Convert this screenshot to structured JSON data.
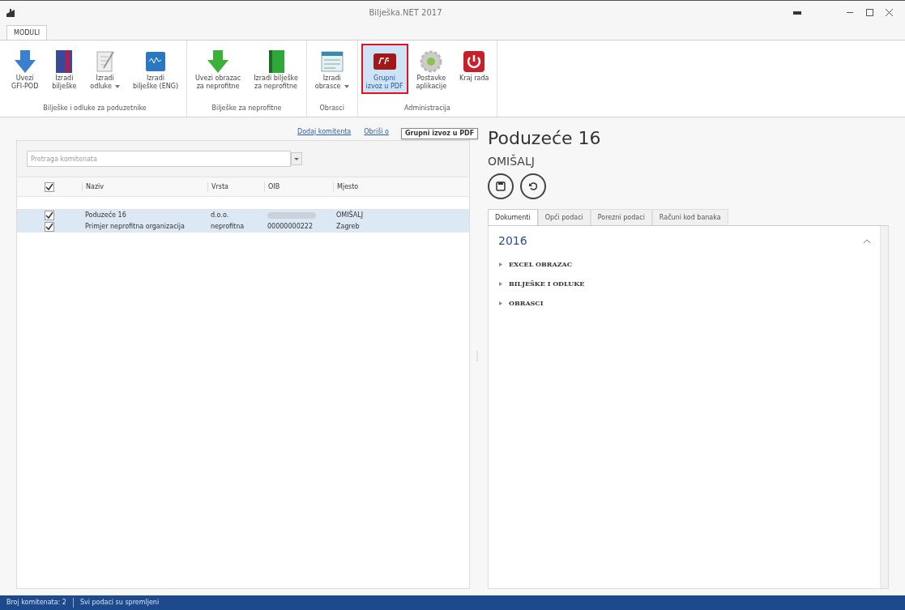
{
  "window": {
    "title": "Bilješka.NET 2017"
  },
  "ribbon": {
    "tabs": [
      {
        "label": "MODULI",
        "selected": true
      }
    ],
    "groups": [
      {
        "label": "Bilješke i odluke za poduzetnike",
        "buttons": [
          {
            "kind": "arrow-blue",
            "lines": [
              "Uvezi",
              "GFI-POD"
            ],
            "dropdown": false,
            "hovered": false
          },
          {
            "kind": "book-red",
            "lines": [
              "Izradi",
              "bilješke"
            ],
            "dropdown": false,
            "hovered": false
          },
          {
            "kind": "paper",
            "lines": [
              "Izradi",
              "odluke"
            ],
            "dropdown": true,
            "hovered": false
          },
          {
            "kind": "book-blue",
            "lines": [
              "Izradi",
              "bilješke (ENG)"
            ],
            "dropdown": false,
            "hovered": false
          }
        ]
      },
      {
        "label": "Bilješke za neprofitne",
        "buttons": [
          {
            "kind": "arrow-green",
            "lines": [
              "Uvezi obrazac",
              "za neprofitne"
            ],
            "dropdown": false,
            "hovered": false
          },
          {
            "kind": "book-green",
            "lines": [
              "Izradi bilješke",
              "za neprofitne"
            ],
            "dropdown": false,
            "hovered": false
          }
        ]
      },
      {
        "label": "Obrasci",
        "buttons": [
          {
            "kind": "form",
            "lines": [
              "Izradi",
              "obrasce"
            ],
            "dropdown": true,
            "hovered": false
          }
        ]
      },
      {
        "label": "Administracija",
        "buttons": [
          {
            "kind": "pdf",
            "lines": [
              "Grupni",
              "izvoz u PDF"
            ],
            "dropdown": false,
            "hovered": true
          },
          {
            "kind": "gear",
            "lines": [
              "Postavke",
              "aplikacije"
            ],
            "dropdown": false,
            "hovered": false
          },
          {
            "kind": "power",
            "lines": [
              "Kraj rada"
            ],
            "dropdown": false,
            "hovered": false
          }
        ]
      }
    ]
  },
  "tooltip": "Grupni izvoz u PDF",
  "links": [
    "Dodaj komitenta",
    "Obriši o"
  ],
  "search": {
    "placeholder": "Pretraga komitenata"
  },
  "table": {
    "all_checked": true,
    "columns": [
      "Naziv",
      "Vrsta",
      "OIB",
      "Mjesto"
    ],
    "rows": [
      {
        "checked": true,
        "selected": true,
        "cells": [
          "Poduzeće 16",
          "d.o.o.",
          null,
          "OMIŠALJ"
        ]
      },
      {
        "checked": true,
        "selected": true,
        "cells": [
          "Primjer neprofitna organizacija",
          "neprofitna",
          "00000000222",
          "Zagreb"
        ]
      }
    ]
  },
  "detail": {
    "title": "Poduzeće 16",
    "subtitle": "OMIŠALJ",
    "tabs": [
      {
        "label": "Dokumenti",
        "selected": true
      },
      {
        "label": "Opći podaci",
        "selected": false
      },
      {
        "label": "Porezni podaci",
        "selected": false
      },
      {
        "label": "Računi kod banaka",
        "selected": false
      }
    ],
    "section": {
      "label": "2016",
      "expanded": true,
      "items": [
        {
          "label": "EXCEL OBRAZAC",
          "expanded": false
        },
        {
          "label": "BILJEŠKE I ODLUKE",
          "expanded": false
        },
        {
          "label": "OBRASCI",
          "expanded": false
        }
      ]
    }
  },
  "status_bar": [
    "Broj komitenata: 2",
    "Svi podaci su spremljeni"
  ]
}
